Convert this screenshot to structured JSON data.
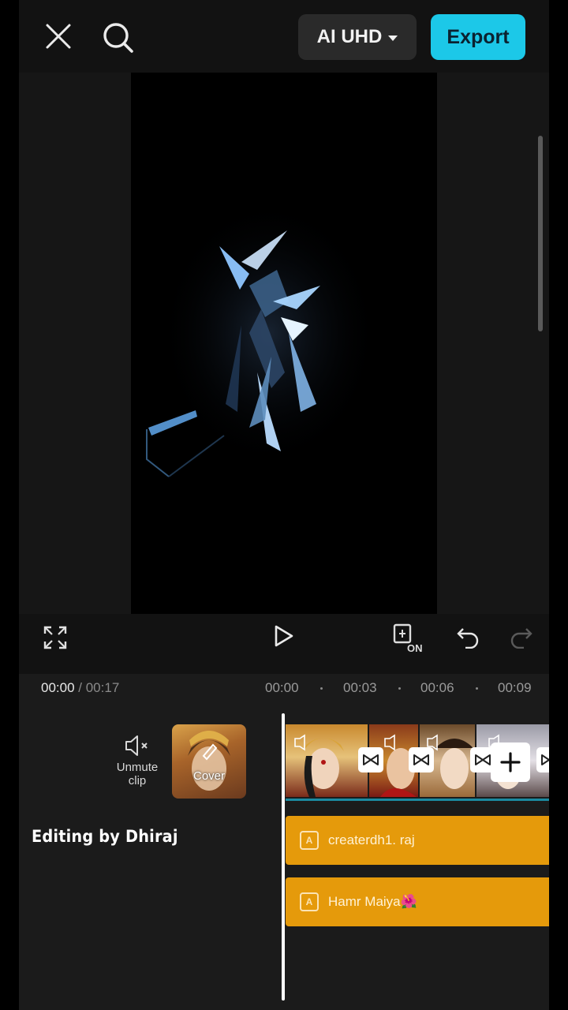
{
  "header": {
    "quality_label": "AI UHD",
    "export_label": "Export"
  },
  "preview": {
    "fullscreen_icon": "fullscreen-icon",
    "play_icon": "play-icon",
    "keyframe_label": "ON",
    "undo_icon": "undo-icon",
    "redo_icon": "redo-icon"
  },
  "timeline": {
    "current_time": "00:00",
    "total_time": "/ 00:17",
    "ruler": [
      "00:00",
      "00:03",
      "00:06",
      "00:09"
    ],
    "unmute_label_line1": "Unmute",
    "unmute_label_line2": "clip",
    "cover_label": "Cover",
    "text_tracks": [
      {
        "label": "createrdh1. raj"
      },
      {
        "label": "Hamr Maiya🌺"
      }
    ]
  },
  "overlay": {
    "watermark": "Editing by Dhiraj"
  },
  "colors": {
    "accent": "#1cc8e8",
    "text_track": "#e59a0b",
    "background": "#121212"
  }
}
